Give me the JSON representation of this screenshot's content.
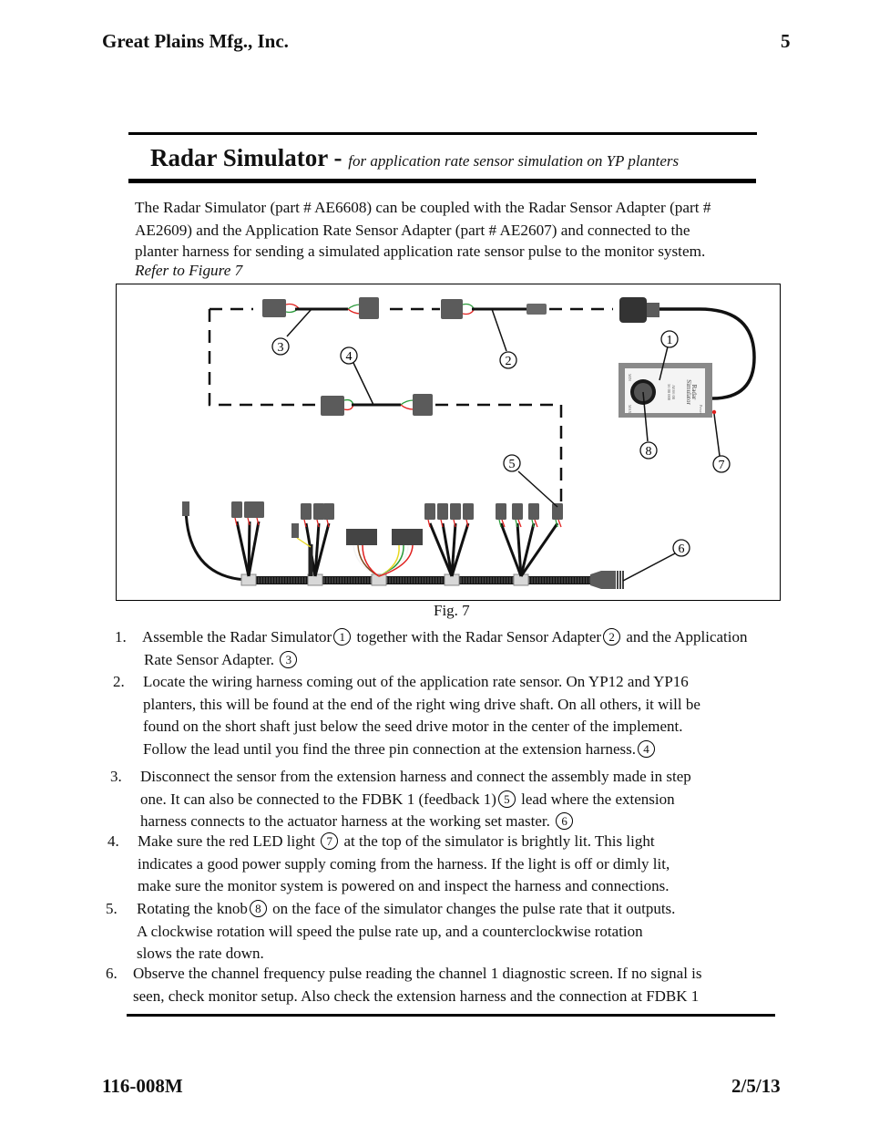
{
  "header": {
    "company": "Great Plains Mfg., Inc.",
    "page_number": "5"
  },
  "section": {
    "title": "Radar Simulator - ",
    "subtitle": "for application rate sensor simulation on YP planters"
  },
  "intro": {
    "lines": [
      "The Radar Simulator (part # AE6608) can be coupled with the Radar Sensor Adapter (part #",
      "AE2609) and the Application Rate Sensor Adapter (part # AE2607) and connected to the",
      "planter harness for sending a simulated application rate sensor pulse to the monitor system."
    ],
    "refer": "Refer to Figure 7"
  },
  "figure": {
    "caption": "Fig. 7",
    "callouts": [
      "1",
      "2",
      "3",
      "4",
      "5",
      "6",
      "7",
      "8"
    ],
    "device_labels": {
      "name_line1": "Radar",
      "name_line2": "Simulator",
      "part_line1": "AE66 08",
      "part_line2": "56 08 000",
      "min": "MIN",
      "max": "MAX",
      "power": "Power"
    },
    "wire_colors": {
      "red": "#e0201e",
      "green": "#2a9a3a",
      "yellow": "#e8d820",
      "brown": "#7a4a20",
      "white": "#f4f4f4",
      "connector": "#5b5b5b",
      "cable": "#111111",
      "junction": "#d8d8d8"
    }
  },
  "steps": [
    {
      "num": "1.",
      "lines": [
        [
          "Assemble the Radar Simulator",
          {
            "c": "1"
          },
          " together with the Radar Sensor Adapter",
          {
            "c": "2"
          },
          " and the Application"
        ],
        [
          "Rate Sensor Adapter. ",
          {
            "c": "3"
          }
        ]
      ]
    },
    {
      "num": "2.",
      "lines": [
        [
          "Locate the wiring harness coming out of the application rate sensor. On YP12 and YP16"
        ],
        [
          "planters, this will be found at the end of the right wing drive shaft. On all others, it will be"
        ],
        [
          "found on the short shaft just below the seed drive motor in the center of the implement."
        ],
        [
          "Follow the lead until you find the three pin connection at the extension harness.",
          {
            "c": "4"
          }
        ]
      ]
    },
    {
      "num": "3.",
      "lines": [
        [
          "Disconnect the sensor from the extension harness and connect the assembly made in step"
        ],
        [
          "one.   It can also be connected to the FDBK 1 (feedback 1)",
          {
            "c": "5"
          },
          " lead where the extension"
        ],
        [
          "harness connects to the actuator harness at the working set master.  ",
          {
            "c": "6"
          }
        ]
      ]
    },
    {
      "num": "4.",
      "lines": [
        [
          "Make sure the red LED light ",
          {
            "c": "7"
          },
          " at the top of the simulator is brightly lit. This light"
        ],
        [
          "indicates a good power supply coming from the harness. If the light is off or dimly lit,"
        ],
        [
          "make sure the monitor system is powered on and inspect the harness and connections."
        ]
      ]
    },
    {
      "num": "5.",
      "lines": [
        [
          "Rotating the knob",
          {
            "c": "8"
          },
          " on the face of the simulator changes the pulse rate that it outputs."
        ],
        [
          "A clockwise rotation will speed the pulse rate up, and a counterclockwise rotation"
        ],
        [
          "slows the rate down."
        ]
      ]
    },
    {
      "num": "6.",
      "lines": [
        [
          "Observe the channel frequency pulse reading the channel 1 diagnostic screen.  If no signal is"
        ],
        [
          "seen, check monitor setup.  Also check the extension harness and the connection at FDBK 1"
        ]
      ]
    }
  ],
  "footer": {
    "doc_number": "116-008M",
    "date": "2/5/13"
  }
}
